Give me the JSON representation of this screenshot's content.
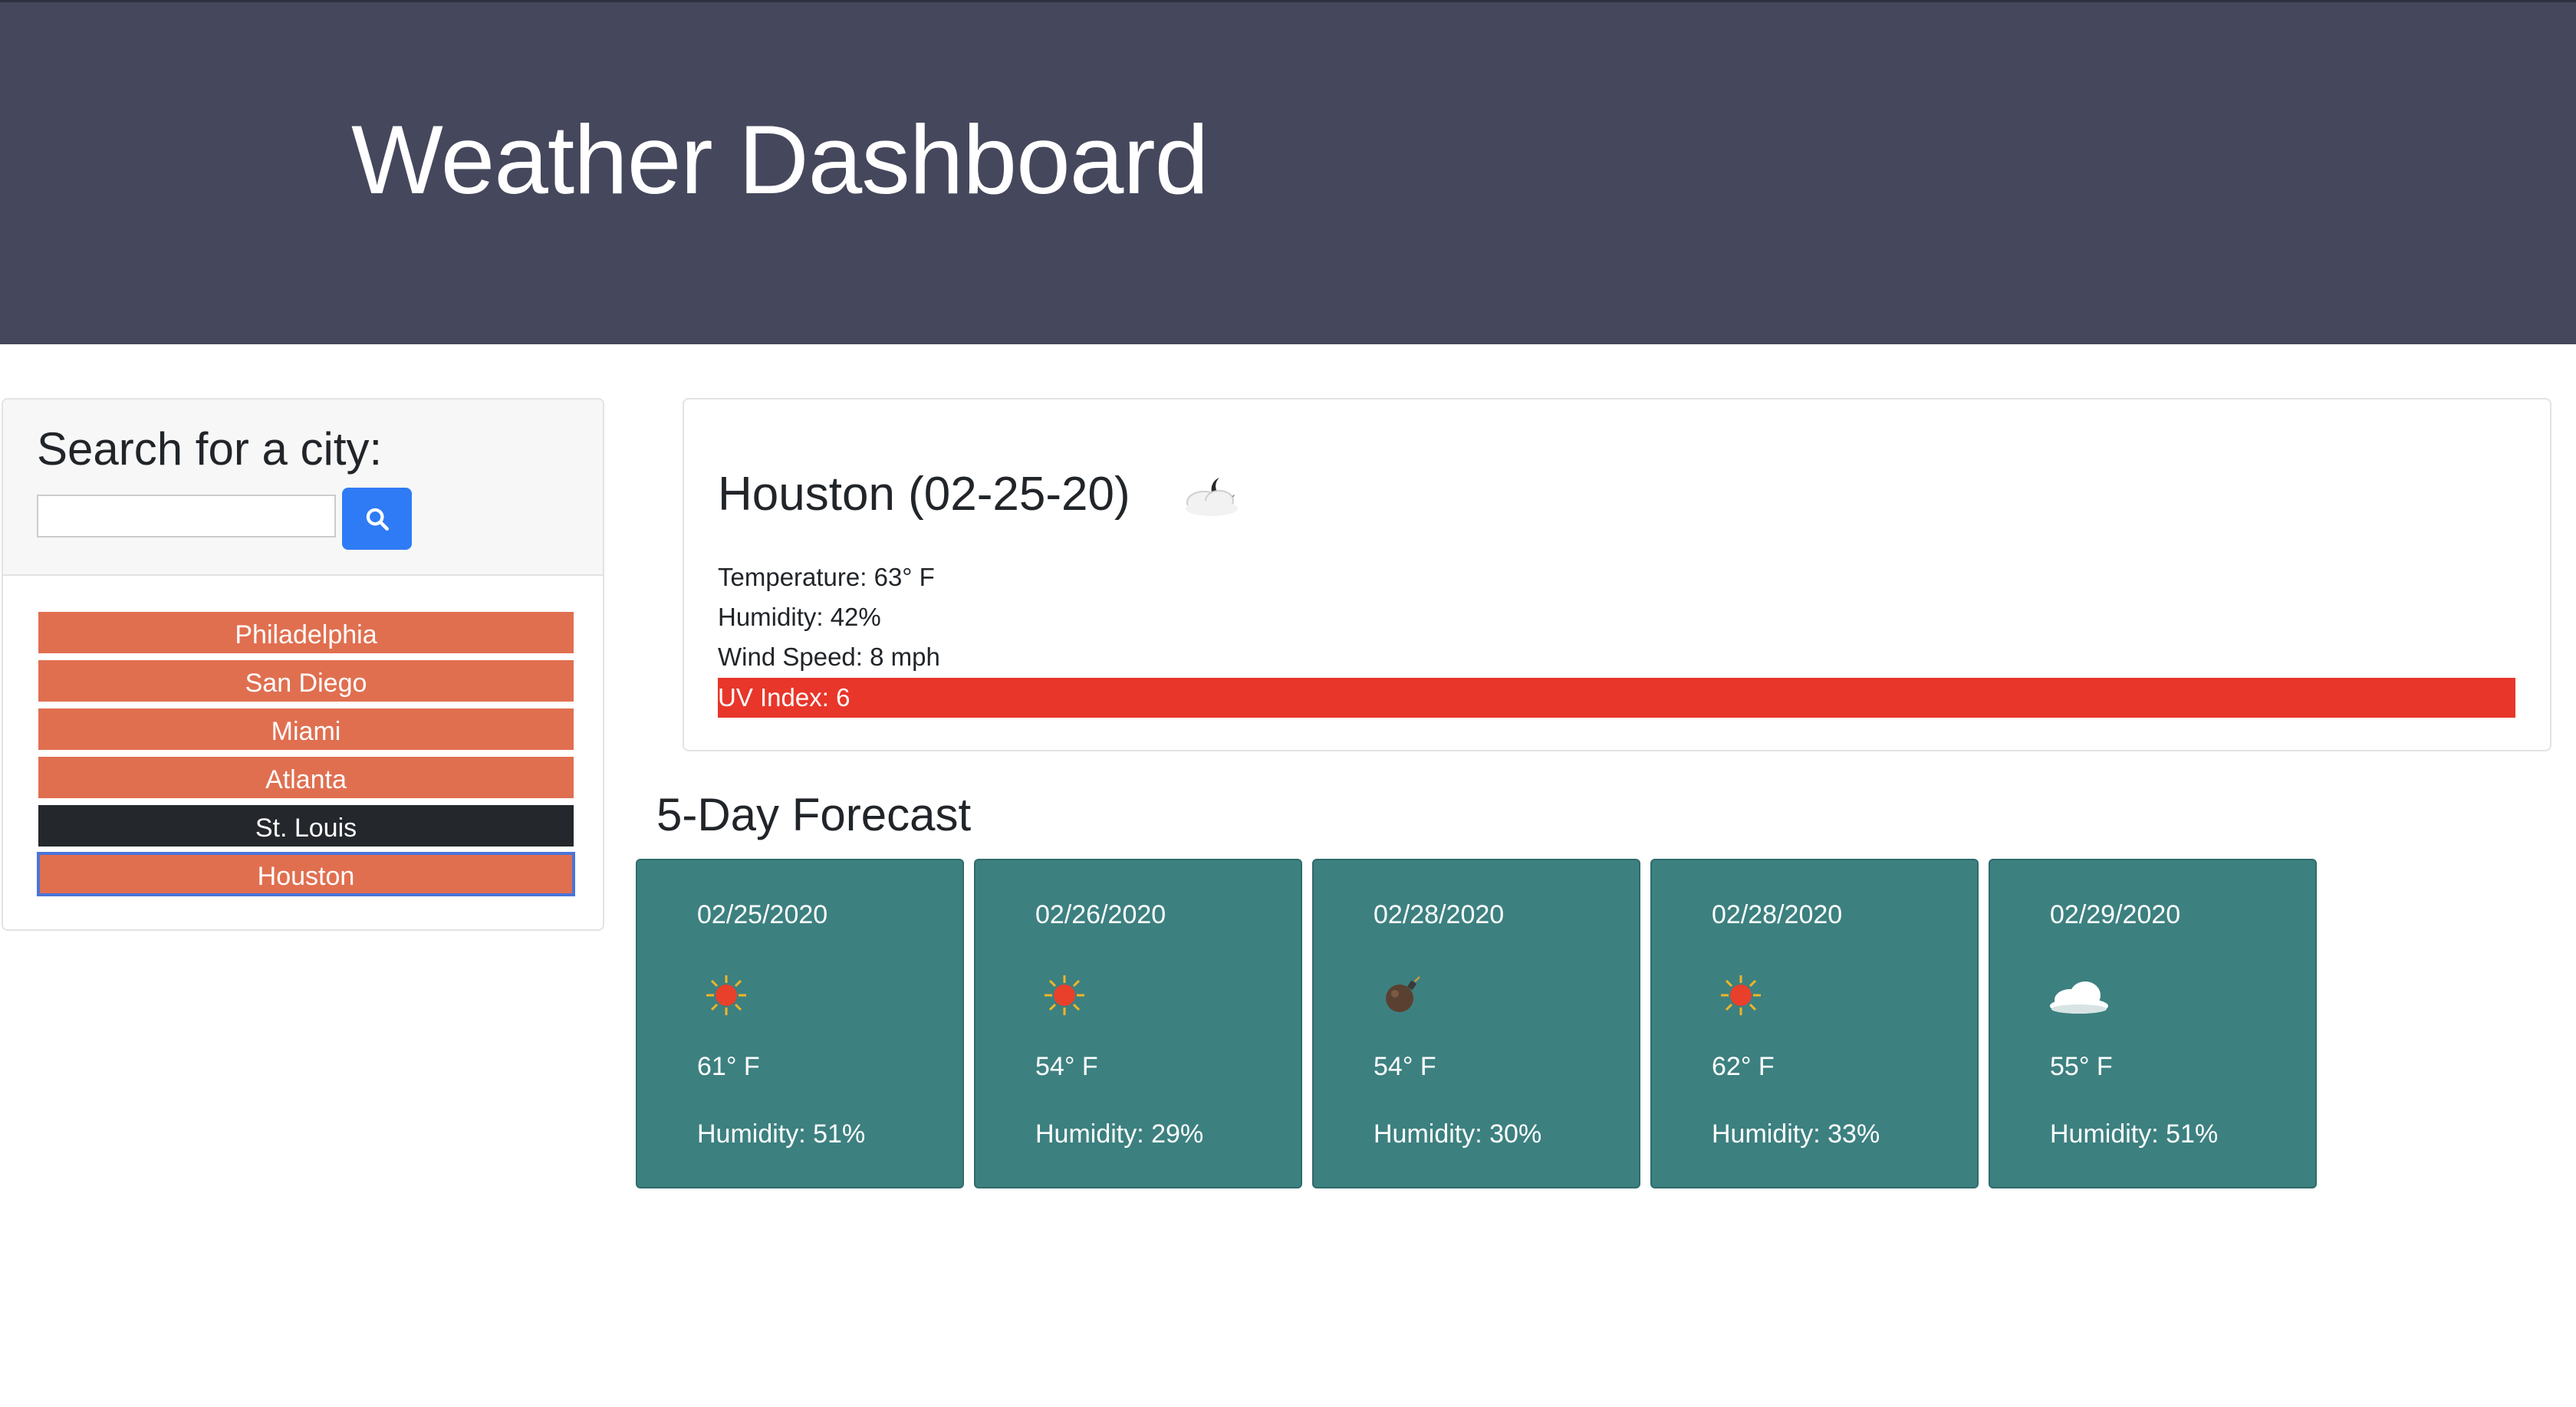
{
  "header": {
    "title": "Weather Dashboard"
  },
  "search": {
    "title": "Search for a city:",
    "input_value": "",
    "placeholder": "",
    "button_icon": "search-icon"
  },
  "cities": [
    {
      "label": "Philadelphia",
      "state": "normal"
    },
    {
      "label": "San Diego",
      "state": "normal"
    },
    {
      "label": "Miami",
      "state": "normal"
    },
    {
      "label": "Atlanta",
      "state": "normal"
    },
    {
      "label": "St. Louis",
      "state": "dark"
    },
    {
      "label": "Houston",
      "state": "active"
    }
  ],
  "current": {
    "title": "Houston (02-25-20)",
    "icon": "cloud-night-icon",
    "temperature": "Temperature: 63° F",
    "humidity": "Humidity: 42%",
    "wind": "Wind Speed: 8 mph",
    "uv": "UV Index: 6",
    "uv_color": "#e8362a"
  },
  "forecast": {
    "title": "5-Day Forecast",
    "days": [
      {
        "date": "02/25/2020",
        "icon": "sun-icon",
        "temp": "61° F",
        "humidity": "Humidity: 51%"
      },
      {
        "date": "02/26/2020",
        "icon": "sun-icon",
        "temp": "54° F",
        "humidity": "Humidity: 29%"
      },
      {
        "date": "02/28/2020",
        "icon": "bomb-icon",
        "temp": "54° F",
        "humidity": "Humidity: 30%"
      },
      {
        "date": "02/28/2020",
        "icon": "sun-icon",
        "temp": "62° F",
        "humidity": "Humidity: 33%"
      },
      {
        "date": "02/29/2020",
        "icon": "cloud-icon",
        "temp": "55° F",
        "humidity": "Humidity: 51%"
      }
    ]
  },
  "colors": {
    "header_bg": "#45475c",
    "city_button": "#e06f50",
    "city_button_dark": "#24272b",
    "search_button": "#2f7bf5",
    "forecast_card": "#3d8080"
  }
}
